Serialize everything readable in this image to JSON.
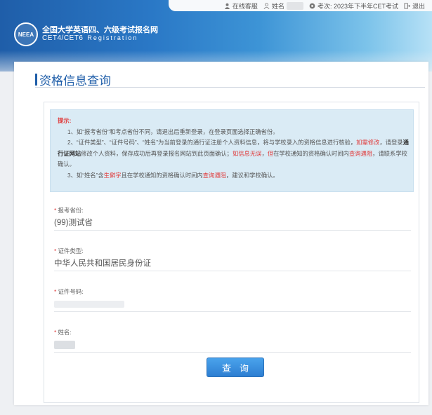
{
  "topbar": {
    "service_label": "在线客服",
    "name_label": "姓名",
    "exam_label": "考次: 2023年下半年CET考试",
    "logout_label": "退出"
  },
  "logo": {
    "emblem_text": "NEEA",
    "title_cn": "全国大学英语四、六级考试报名网",
    "title_en": "CET4/CET6",
    "title_reg": "Registration"
  },
  "page": {
    "title": "资格信息查询"
  },
  "notice": {
    "title": "提示:",
    "line1": "1、如“报考省份”和考点省份不同，请退出后重新登录，在登录页面选择正确省份。",
    "line2_a": "2、“证件类型”、“证件号码”、“姓名”为当前登录的通行证注册个人资料信息，将与学校录入的资格信息进行核验，",
    "line2_b": "如需修改",
    "line2_c": "，请登录",
    "line2_d": "通行证网站",
    "line2_e": "修改个人资料，保存成功后再登录报名网站到此页面确认；",
    "line2_f": "如信息无误",
    "line2_g": "，",
    "line2_h": "但",
    "line2_i": "在学校通知的资格确认时间内",
    "line2_j": "查询遇阻",
    "line2_k": "，请联系学校确认。",
    "line3_a": "3、如“姓名”含",
    "line3_b": "生僻字",
    "line3_c": "且在学校通知的资格确认时间内",
    "line3_d": "查询遇阻",
    "line3_e": "，建议和学校确认。"
  },
  "form": {
    "province_label": "报考省份:",
    "province_value": "(99)测试省",
    "id_type_label": "证件类型:",
    "id_type_value": "中华人民共和国居民身份证",
    "id_number_label": "证件号码:",
    "name_label": "姓名:",
    "required_mark": "*",
    "submit_label": "查询"
  },
  "colors": {
    "brand_blue": "#1f5ea9",
    "notice_bg": "#daebf5",
    "warning_red": "#e03a3a",
    "button_blue": "#2d7ed2"
  },
  "icons": [
    "service-icon",
    "user-icon",
    "exam-icon",
    "logout-icon",
    "neea-emblem-icon"
  ]
}
